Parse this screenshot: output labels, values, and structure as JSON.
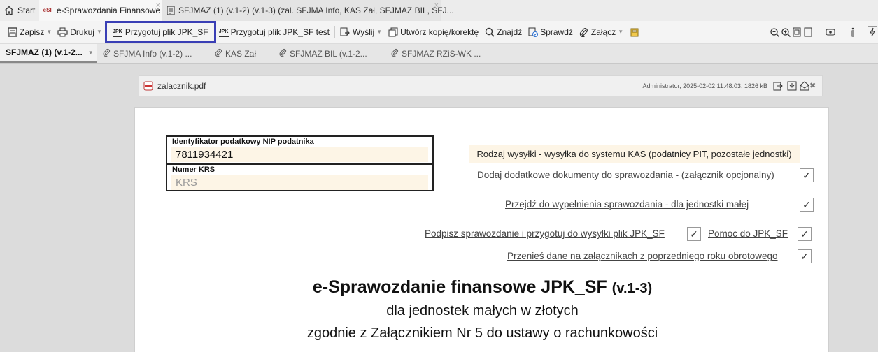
{
  "tabs": [
    {
      "label": "Start",
      "icon": "home-icon"
    },
    {
      "label": "e-Sprawozdania Finansowe",
      "icon": "esf-icon"
    },
    {
      "label": "SFJMAZ (1) (v.1-2) (v.1-3) (zał. SFJMA Info, KAS Zał, SFJMAZ BIL, SFJ...",
      "icon": "document-icon"
    }
  ],
  "tab_close": "×",
  "toolbar": {
    "zapisz": "Zapisz",
    "drukuj": "Drukuj",
    "przygotuj_jpk": "Przygotuj plik JPK_SF",
    "przygotuj_jpk_test": "Przygotuj plik JPK_SF test",
    "wyslij": "Wyślij",
    "utworz_kopie": "Utwórz kopię/korektę",
    "znajdz": "Znajdź",
    "sprawdz": "Sprawdź",
    "zalacz": "Załącz",
    "caret": "▼",
    "jpk_icon_text": "JPK"
  },
  "doc_tabs": {
    "active": "SFJMAZ (1) (v.1-2...",
    "items": [
      "SFJMA Info (v.1-2) ...",
      "KAS Zał",
      "SFJMAZ BIL (v.1-2...",
      "SFJMAZ RZiS-WK ..."
    ],
    "caret": "▼"
  },
  "attachment": {
    "filename": "zalacznik.pdf",
    "meta": "Administrator, 2025-02-02 11:48:03, 1826 kB",
    "close": "✖"
  },
  "form": {
    "nip_label": "Identyfikator podatkowy NIP podatnika",
    "nip_value": "7811934421",
    "krs_label": "Numer KRS",
    "krs_placeholder": "KRS",
    "rodzaj_wysylki": "Rodzaj wysyłki - wysyłka do systemu KAS (podatnicy PIT, pozostałe jednostki)",
    "dodaj_dokumenty": "Dodaj dodatkowe dokumenty do sprawozdania - (załącznik opcjonalny)",
    "przejdz": "Przejdź do wypełnienia sprawozdania - dla jednostki małej",
    "podpisz": "Podpisz sprawozdanie i przygotuj do wysyłki plik JPK_SF",
    "pomoc": "Pomoc do JPK_SF",
    "przenies": "Przenieś dane na załącznikach z poprzedniego roku obrotowego",
    "check": "✓",
    "title_main": "e-Sprawozdanie finansowe JPK_SF",
    "title_version": "(v.1-3)",
    "subtitle1": "dla jednostek małych w złotych",
    "subtitle2": "zgodnie z Załącznikiem Nr 5 do ustawy o rachunkowości"
  },
  "colors": {
    "highlight_border": "#3a3fb5",
    "field_bg": "#fdf5e6"
  }
}
